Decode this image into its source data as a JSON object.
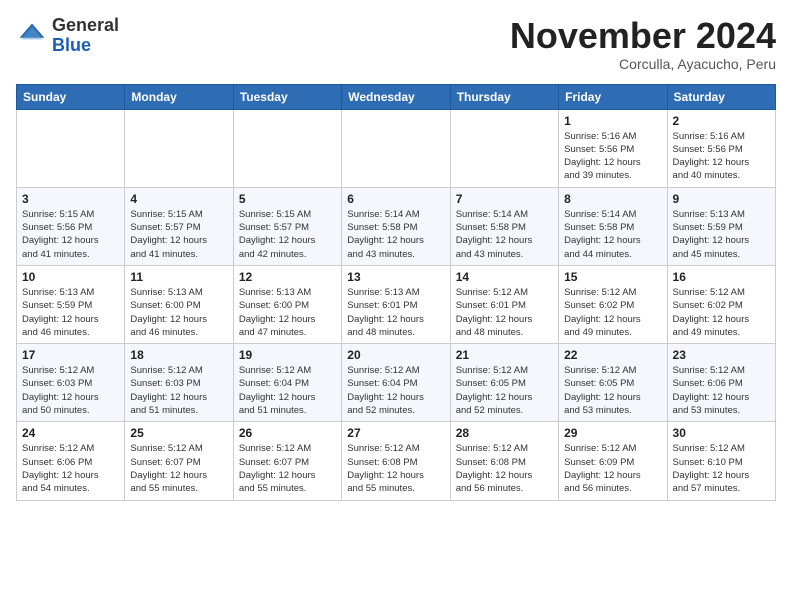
{
  "header": {
    "logo": {
      "line1": "General",
      "line2": "Blue"
    },
    "title": "November 2024",
    "subtitle": "Corculla, Ayacucho, Peru"
  },
  "weekdays": [
    "Sunday",
    "Monday",
    "Tuesday",
    "Wednesday",
    "Thursday",
    "Friday",
    "Saturday"
  ],
  "weeks": [
    [
      {
        "day": "",
        "info": ""
      },
      {
        "day": "",
        "info": ""
      },
      {
        "day": "",
        "info": ""
      },
      {
        "day": "",
        "info": ""
      },
      {
        "day": "",
        "info": ""
      },
      {
        "day": "1",
        "info": "Sunrise: 5:16 AM\nSunset: 5:56 PM\nDaylight: 12 hours\nand 39 minutes."
      },
      {
        "day": "2",
        "info": "Sunrise: 5:16 AM\nSunset: 5:56 PM\nDaylight: 12 hours\nand 40 minutes."
      }
    ],
    [
      {
        "day": "3",
        "info": "Sunrise: 5:15 AM\nSunset: 5:56 PM\nDaylight: 12 hours\nand 41 minutes."
      },
      {
        "day": "4",
        "info": "Sunrise: 5:15 AM\nSunset: 5:57 PM\nDaylight: 12 hours\nand 41 minutes."
      },
      {
        "day": "5",
        "info": "Sunrise: 5:15 AM\nSunset: 5:57 PM\nDaylight: 12 hours\nand 42 minutes."
      },
      {
        "day": "6",
        "info": "Sunrise: 5:14 AM\nSunset: 5:58 PM\nDaylight: 12 hours\nand 43 minutes."
      },
      {
        "day": "7",
        "info": "Sunrise: 5:14 AM\nSunset: 5:58 PM\nDaylight: 12 hours\nand 43 minutes."
      },
      {
        "day": "8",
        "info": "Sunrise: 5:14 AM\nSunset: 5:58 PM\nDaylight: 12 hours\nand 44 minutes."
      },
      {
        "day": "9",
        "info": "Sunrise: 5:13 AM\nSunset: 5:59 PM\nDaylight: 12 hours\nand 45 minutes."
      }
    ],
    [
      {
        "day": "10",
        "info": "Sunrise: 5:13 AM\nSunset: 5:59 PM\nDaylight: 12 hours\nand 46 minutes."
      },
      {
        "day": "11",
        "info": "Sunrise: 5:13 AM\nSunset: 6:00 PM\nDaylight: 12 hours\nand 46 minutes."
      },
      {
        "day": "12",
        "info": "Sunrise: 5:13 AM\nSunset: 6:00 PM\nDaylight: 12 hours\nand 47 minutes."
      },
      {
        "day": "13",
        "info": "Sunrise: 5:13 AM\nSunset: 6:01 PM\nDaylight: 12 hours\nand 48 minutes."
      },
      {
        "day": "14",
        "info": "Sunrise: 5:12 AM\nSunset: 6:01 PM\nDaylight: 12 hours\nand 48 minutes."
      },
      {
        "day": "15",
        "info": "Sunrise: 5:12 AM\nSunset: 6:02 PM\nDaylight: 12 hours\nand 49 minutes."
      },
      {
        "day": "16",
        "info": "Sunrise: 5:12 AM\nSunset: 6:02 PM\nDaylight: 12 hours\nand 49 minutes."
      }
    ],
    [
      {
        "day": "17",
        "info": "Sunrise: 5:12 AM\nSunset: 6:03 PM\nDaylight: 12 hours\nand 50 minutes."
      },
      {
        "day": "18",
        "info": "Sunrise: 5:12 AM\nSunset: 6:03 PM\nDaylight: 12 hours\nand 51 minutes."
      },
      {
        "day": "19",
        "info": "Sunrise: 5:12 AM\nSunset: 6:04 PM\nDaylight: 12 hours\nand 51 minutes."
      },
      {
        "day": "20",
        "info": "Sunrise: 5:12 AM\nSunset: 6:04 PM\nDaylight: 12 hours\nand 52 minutes."
      },
      {
        "day": "21",
        "info": "Sunrise: 5:12 AM\nSunset: 6:05 PM\nDaylight: 12 hours\nand 52 minutes."
      },
      {
        "day": "22",
        "info": "Sunrise: 5:12 AM\nSunset: 6:05 PM\nDaylight: 12 hours\nand 53 minutes."
      },
      {
        "day": "23",
        "info": "Sunrise: 5:12 AM\nSunset: 6:06 PM\nDaylight: 12 hours\nand 53 minutes."
      }
    ],
    [
      {
        "day": "24",
        "info": "Sunrise: 5:12 AM\nSunset: 6:06 PM\nDaylight: 12 hours\nand 54 minutes."
      },
      {
        "day": "25",
        "info": "Sunrise: 5:12 AM\nSunset: 6:07 PM\nDaylight: 12 hours\nand 55 minutes."
      },
      {
        "day": "26",
        "info": "Sunrise: 5:12 AM\nSunset: 6:07 PM\nDaylight: 12 hours\nand 55 minutes."
      },
      {
        "day": "27",
        "info": "Sunrise: 5:12 AM\nSunset: 6:08 PM\nDaylight: 12 hours\nand 55 minutes."
      },
      {
        "day": "28",
        "info": "Sunrise: 5:12 AM\nSunset: 6:08 PM\nDaylight: 12 hours\nand 56 minutes."
      },
      {
        "day": "29",
        "info": "Sunrise: 5:12 AM\nSunset: 6:09 PM\nDaylight: 12 hours\nand 56 minutes."
      },
      {
        "day": "30",
        "info": "Sunrise: 5:12 AM\nSunset: 6:10 PM\nDaylight: 12 hours\nand 57 minutes."
      }
    ]
  ]
}
